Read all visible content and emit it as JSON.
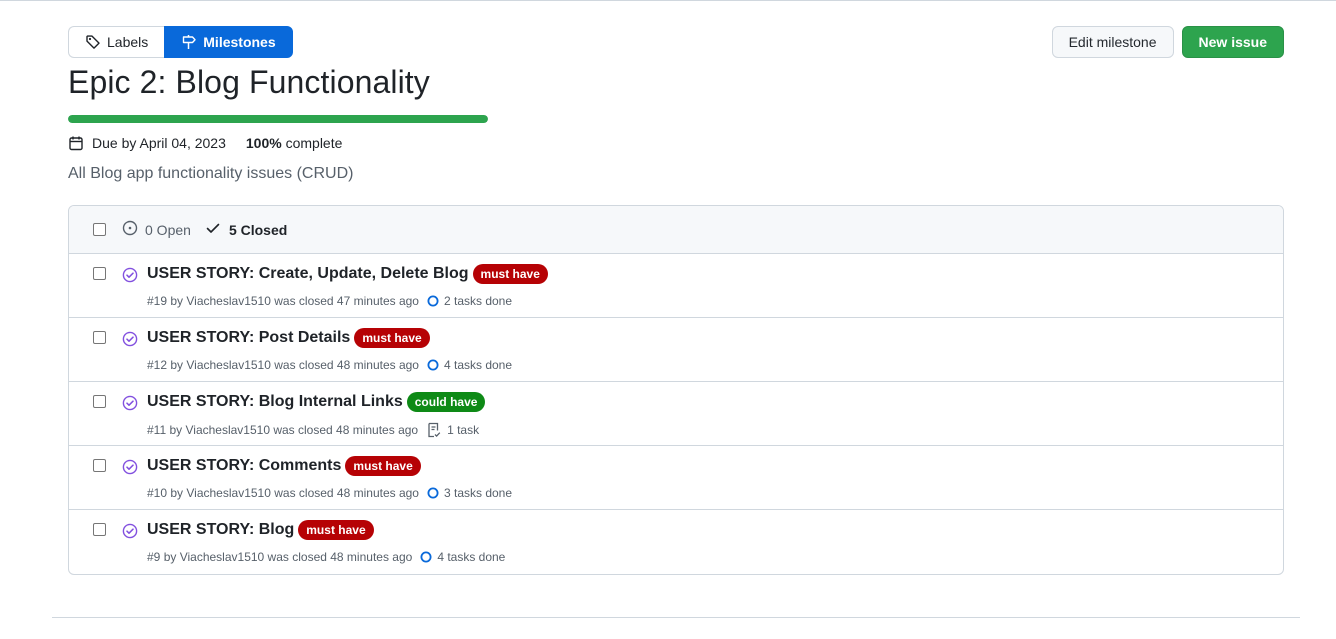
{
  "subnav": {
    "labels_label": "Labels",
    "milestones_label": "Milestones"
  },
  "actions": {
    "edit_label": "Edit milestone",
    "new_issue_label": "New issue"
  },
  "milestone": {
    "title": "Epic 2: Blog Functionality",
    "progress_percent": 100,
    "due_text": "Due by April 04, 2023",
    "percent_text": "100%",
    "complete_text": "complete",
    "description": "All Blog app functionality issues (CRUD)"
  },
  "filter": {
    "open_text": "0 Open",
    "closed_text": "5 Closed"
  },
  "colors": {
    "accent_blue": "#0969da",
    "green": "#2da44e",
    "closed_purple": "#8250df",
    "must_have": "#b60205",
    "could_have": "#0e8a16"
  },
  "issues": [
    {
      "title": "USER STORY: Create, Update, Delete Blog",
      "label": "must have",
      "label_color": "#b60205",
      "number": "#19",
      "meta": "by Viacheslav1510 was closed 47 minutes ago",
      "tasks": "2 tasks done",
      "task_icon": "circle-icon"
    },
    {
      "title": "USER STORY: Post Details",
      "label": "must have",
      "label_color": "#b60205",
      "number": "#12",
      "meta": "by Viacheslav1510 was closed 48 minutes ago",
      "tasks": "4 tasks done",
      "task_icon": "circle-icon"
    },
    {
      "title": "USER STORY: Blog Internal Links",
      "label": "could have",
      "label_color": "#0e8a16",
      "number": "#11",
      "meta": "by Viacheslav1510 was closed 48 minutes ago",
      "tasks": "1 task",
      "task_icon": "checklist-icon"
    },
    {
      "title": "USER STORY: Comments",
      "label": "must have",
      "label_color": "#b60205",
      "number": "#10",
      "meta": "by Viacheslav1510 was closed 48 minutes ago",
      "tasks": "3 tasks done",
      "task_icon": "circle-icon"
    },
    {
      "title": "USER STORY: Blog",
      "label": "must have",
      "label_color": "#b60205",
      "number": "#9",
      "meta": "by Viacheslav1510 was closed 48 minutes ago",
      "tasks": "4 tasks done",
      "task_icon": "circle-icon"
    }
  ]
}
